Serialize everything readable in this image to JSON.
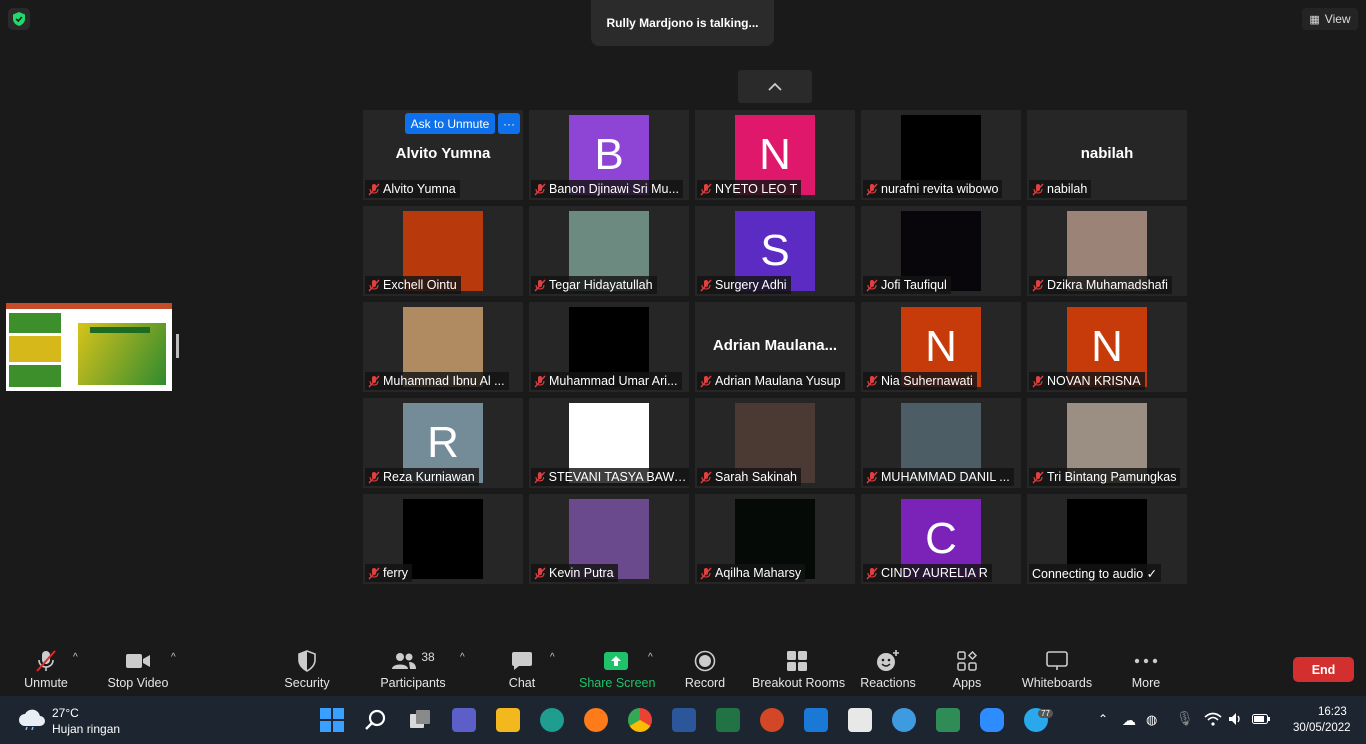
{
  "window": {
    "talking_text": "Rully Mardjono is talking...",
    "view_label": "View"
  },
  "ask_to_unmute": "Ask to Unmute",
  "more_dots": "···",
  "participants": [
    {
      "name": "Alvito Yumna",
      "display": "Alvito Yumna",
      "type": "name"
    },
    {
      "name": "Banon Djinawi Sri Mu...",
      "letter": "B",
      "color": "#8e44d4",
      "type": "letter"
    },
    {
      "name": "NYETO LEO T",
      "letter": "N",
      "color": "#e0186c",
      "type": "letter"
    },
    {
      "name": "nurafni revita wibowo",
      "color": "#000000",
      "type": "video"
    },
    {
      "name": "nabilah",
      "display": "nabilah",
      "type": "name"
    },
    {
      "name": "Exchell Ointu",
      "color": "#b83a0c",
      "type": "video"
    },
    {
      "name": "Tegar Hidayatullah",
      "color": "#6d8a80",
      "type": "video"
    },
    {
      "name": "Surgery Adhi",
      "letter": "S",
      "color": "#5b2bc4",
      "type": "letter"
    },
    {
      "name": "Jofi Taufiqul",
      "color": "#08060a",
      "type": "video"
    },
    {
      "name": "Dzikra Muhamadshafi",
      "color": "#9b8378",
      "type": "video"
    },
    {
      "name": "Muhammad Ibnu Al ...",
      "color": "#b08a60",
      "type": "video"
    },
    {
      "name": "Muhammad Umar Ari...",
      "color": "#000000",
      "type": "video"
    },
    {
      "name": "Adrian Maulana Yusup",
      "display": "Adrian  Maulana...",
      "type": "name"
    },
    {
      "name": "Nia Suhernawati",
      "letter": "N",
      "color": "#c73b0b",
      "type": "letter"
    },
    {
      "name": "NOVAN KRISNA",
      "letter": "N",
      "color": "#c73b0b",
      "type": "letter"
    },
    {
      "name": "Reza Kurniawan",
      "letter": "R",
      "color": "#748b98",
      "type": "letter"
    },
    {
      "name": "STEVANI TASYA BAWA...",
      "color": "#ffffff",
      "type": "video"
    },
    {
      "name": "Sarah Sakinah",
      "color": "#4a3a33",
      "type": "video"
    },
    {
      "name": "MUHAMMAD DANIL ...",
      "color": "#4d5d66",
      "type": "video"
    },
    {
      "name": "Tri Bintang Pamungkas",
      "color": "#9a8f82",
      "type": "video"
    },
    {
      "name": "ferry",
      "color": "#000000",
      "type": "video"
    },
    {
      "name": "Kevin Putra",
      "color": "#6a4a8c",
      "type": "video"
    },
    {
      "name": "Aqilha Maharsy",
      "color": "#050a06",
      "type": "video"
    },
    {
      "name": "CINDY AURELIA R",
      "letter": "C",
      "color": "#7b22b8",
      "type": "letter"
    },
    {
      "name": "Connecting to audio ✓",
      "color": "#000000",
      "type": "video",
      "nomic": true
    }
  ],
  "toolbar": {
    "unmute": "Unmute",
    "stop_video": "Stop Video",
    "security": "Security",
    "participants": "Participants",
    "participants_count": "38",
    "chat": "Chat",
    "share_screen": "Share Screen",
    "record": "Record",
    "breakout": "Breakout Rooms",
    "reactions": "Reactions",
    "apps": "Apps",
    "whiteboards": "Whiteboards",
    "more": "More",
    "end": "End"
  },
  "taskbar": {
    "temperature": "27°C",
    "weather": "Hujan ringan",
    "time": "16:23",
    "date": "30/05/2022",
    "telegram_badge": "77"
  },
  "colors": {
    "accent": "#0e71eb",
    "share_green": "#1fc26a",
    "end_red": "#d32f2f"
  }
}
